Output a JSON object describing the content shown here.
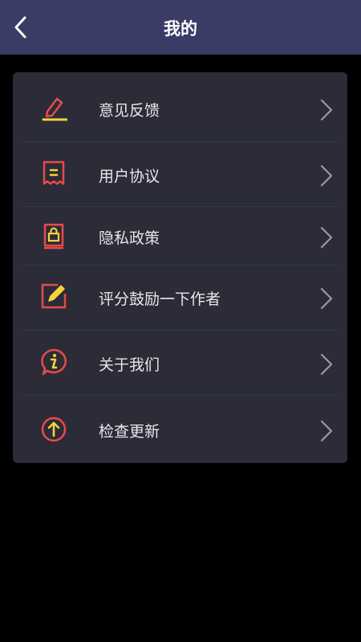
{
  "header": {
    "title": "我的",
    "background": "#3a3c66"
  },
  "menu": {
    "items": [
      {
        "label": "意见反馈",
        "icon": "edit-feedback-icon"
      },
      {
        "label": "用户协议",
        "icon": "agreement-document-icon"
      },
      {
        "label": "隐私政策",
        "icon": "privacy-lock-icon"
      },
      {
        "label": "评分鼓励一下作者",
        "icon": "rate-pencil-icon"
      },
      {
        "label": "关于我们",
        "icon": "info-bubble-icon"
      },
      {
        "label": "检查更新",
        "icon": "update-arrow-icon"
      }
    ]
  },
  "colors": {
    "icon_red": "#e84a4a",
    "icon_yellow": "#f2d43c",
    "card_bg": "#2b2c37",
    "page_bg": "#000000"
  }
}
